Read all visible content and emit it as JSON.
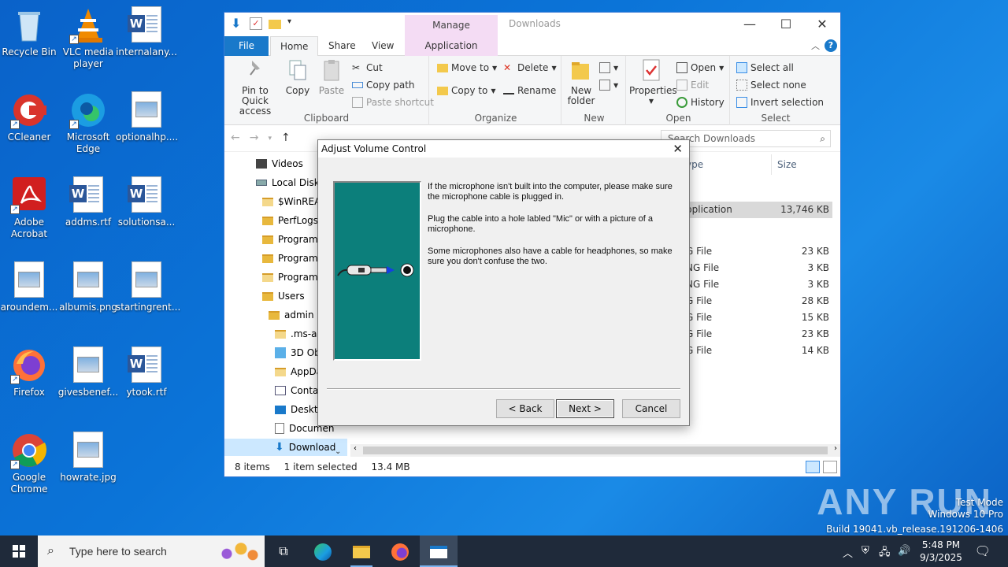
{
  "desktop": {
    "icons": [
      {
        "label": "Recycle Bin"
      },
      {
        "label": "VLC media player"
      },
      {
        "label": "internalany..."
      },
      {
        "label": "CCleaner"
      },
      {
        "label": "Microsoft Edge"
      },
      {
        "label": "optionalhp...."
      },
      {
        "label": "Adobe Acrobat"
      },
      {
        "label": "addms.rtf"
      },
      {
        "label": "solutionsa..."
      },
      {
        "label": "aroundem..."
      },
      {
        "label": "albumis.png"
      },
      {
        "label": "startingrent..."
      },
      {
        "label": "Firefox"
      },
      {
        "label": "givesbenef..."
      },
      {
        "label": "ytook.rtf"
      },
      {
        "label": "Google Chrome"
      },
      {
        "label": "howrate.jpg"
      }
    ]
  },
  "explorer": {
    "title": "Downloads",
    "context_tab": "Manage",
    "tabs": {
      "file": "File",
      "home": "Home",
      "share": "Share",
      "view": "View",
      "app_tools": "Application Tools"
    },
    "ribbon": {
      "clipboard": {
        "label": "Clipboard",
        "pin": "Pin to Quick access",
        "copy": "Copy",
        "paste": "Paste",
        "cut": "Cut",
        "copy_path": "Copy path",
        "paste_shortcut": "Paste shortcut"
      },
      "organize": {
        "label": "Organize",
        "move_to": "Move to",
        "copy_to": "Copy to",
        "delete": "Delete",
        "rename": "Rename"
      },
      "new": {
        "label": "New",
        "new_folder": "New folder"
      },
      "open": {
        "label": "Open",
        "properties": "Properties",
        "open": "Open",
        "edit": "Edit",
        "history": "History"
      },
      "select": {
        "label": "Select",
        "select_all": "Select all",
        "select_none": "Select none",
        "invert": "Invert selection"
      }
    },
    "search_placeholder": "Search Downloads",
    "nav": [
      {
        "label": "Videos"
      },
      {
        "label": "Local Disk ("
      },
      {
        "label": "$WinREAg"
      },
      {
        "label": "PerfLogs"
      },
      {
        "label": "Program F"
      },
      {
        "label": "Program F"
      },
      {
        "label": "ProgramD"
      },
      {
        "label": "Users"
      },
      {
        "label": "admin"
      },
      {
        "label": ".ms-ad"
      },
      {
        "label": "3D Obj"
      },
      {
        "label": "AppDa"
      },
      {
        "label": "Contac"
      },
      {
        "label": "Deskto"
      },
      {
        "label": "Documen"
      },
      {
        "label": "Download"
      }
    ],
    "columns": {
      "type": "ype",
      "size": "Size"
    },
    "files": [
      {
        "type": "pplication",
        "size": "13,746 KB"
      },
      {
        "type": "G File",
        "size": "23 KB"
      },
      {
        "type": "NG File",
        "size": "3 KB"
      },
      {
        "type": "NG File",
        "size": "3 KB"
      },
      {
        "type": "G File",
        "size": "28 KB"
      },
      {
        "type": "G File",
        "size": "15 KB"
      },
      {
        "type": "G File",
        "size": "23 KB"
      },
      {
        "type": "G File",
        "size": "14 KB"
      }
    ],
    "status": {
      "items": "8 items",
      "selected": "1 item selected",
      "size": "13.4 MB"
    }
  },
  "dialog": {
    "title": "Adjust Volume Control",
    "paragraphs": [
      "If the microphone isn't built into the computer, please make sure the microphone cable is plugged in.",
      "Plug the cable into a hole labled \"Mic\" or with a picture of a microphone.",
      "Some microphones also  have a cable for headphones, so make sure you don't confuse the two."
    ],
    "back": "< Back",
    "next": "Next >",
    "cancel": "Cancel"
  },
  "watermark": {
    "brand": "ANY RUN",
    "mode": "Test Mode",
    "edition": "Windows 10 Pro",
    "build": "Build 19041.vb_release.191206-1406"
  },
  "taskbar": {
    "search_placeholder": "Type here to search",
    "time": "5:48 PM",
    "date": "9/3/2025"
  }
}
